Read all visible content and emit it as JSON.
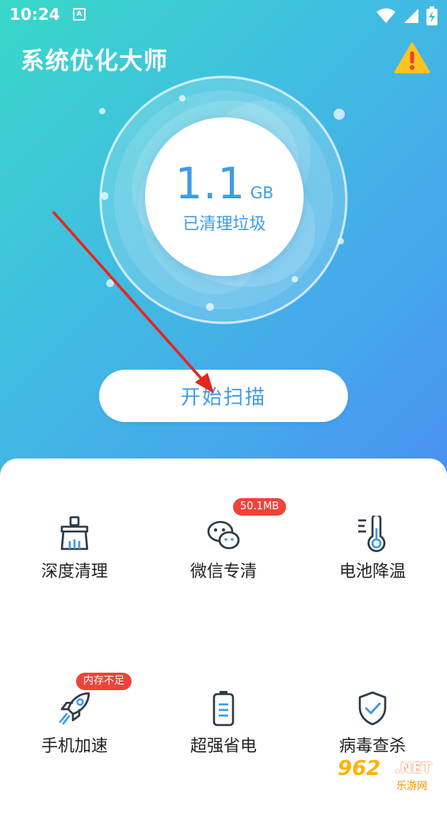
{
  "status_bar": {
    "time": "10:24",
    "notification_icon": "A",
    "icons": [
      "wifi-icon",
      "signal-icon",
      "battery-charging-icon"
    ]
  },
  "header": {
    "title": "系统优化大师",
    "warning_icon": "warning-icon"
  },
  "cleaned": {
    "value": "1.1",
    "unit": "GB",
    "label": "已清理垃圾"
  },
  "scan_button": {
    "label": "开始扫描"
  },
  "tools": [
    {
      "label": "深度清理",
      "icon": "broom-icon",
      "badge": ""
    },
    {
      "label": "微信专清",
      "icon": "wechat-icon",
      "badge": "50.1MB"
    },
    {
      "label": "电池降温",
      "icon": "thermometer-icon",
      "badge": ""
    },
    {
      "label": "手机加速",
      "icon": "rocket-icon",
      "badge": "内存不足"
    },
    {
      "label": "超强省电",
      "icon": "battery-icon",
      "badge": ""
    },
    {
      "label": "病毒查杀",
      "icon": "shield-check-icon",
      "badge": ""
    }
  ],
  "colors": {
    "accent": "#3f9be6",
    "badge": "#ef4339",
    "gradient_start": "#39d8c8",
    "gradient_end": "#4a8ef2"
  },
  "watermark": {
    "logo_text": "962.NET",
    "sub_text": "乐游网"
  }
}
